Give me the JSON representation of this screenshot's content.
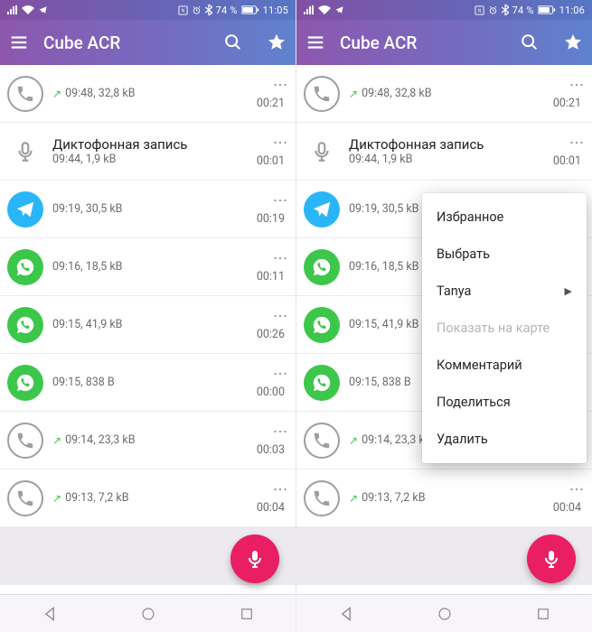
{
  "left": {
    "statusbar": {
      "battery": "74 %",
      "time": "11:05"
    },
    "appbar": {
      "title": "Cube ACR"
    }
  },
  "right": {
    "statusbar": {
      "battery": "74 %",
      "time": "11:06"
    },
    "appbar": {
      "title": "Cube ACR"
    }
  },
  "rows": [
    {
      "type": "phone",
      "title": " ",
      "arrow": true,
      "meta": "09:48, 32,8 kB",
      "dur": "00:21"
    },
    {
      "type": "mic",
      "title": "Диктофонная запись",
      "arrow": false,
      "meta": "09:44, 1,9 kB",
      "dur": "00:01"
    },
    {
      "type": "telegram",
      "title": " ",
      "arrow": false,
      "meta": "09:19, 30,5 kB",
      "dur": "00:19"
    },
    {
      "type": "whatsapp",
      "title": " ",
      "arrow": false,
      "meta": "09:16, 18,5 kB",
      "dur": "00:11"
    },
    {
      "type": "whatsapp",
      "title": " ",
      "arrow": false,
      "meta": "09:15, 41,9 kB",
      "dur": "00:26"
    },
    {
      "type": "whatsapp",
      "title": " ",
      "arrow": false,
      "meta": "09:15, 838 B",
      "dur": "00:00"
    },
    {
      "type": "phone",
      "title": " ",
      "arrow": true,
      "meta": "09:14, 23,3 kB",
      "dur": "00:03"
    },
    {
      "type": "phone",
      "title": " ",
      "arrow": true,
      "meta": "09:13, 7,2 kB",
      "dur": "00:04"
    }
  ],
  "ctx": {
    "items": [
      {
        "label": "Избранное",
        "disabled": false,
        "sub": false
      },
      {
        "label": "Выбрать",
        "disabled": false,
        "sub": false
      },
      {
        "label": "Tanya",
        "disabled": false,
        "sub": true
      },
      {
        "label": "Показать на карте",
        "disabled": true,
        "sub": false
      },
      {
        "label": "Комментарий",
        "disabled": false,
        "sub": false
      },
      {
        "label": "Поделиться",
        "disabled": false,
        "sub": false
      },
      {
        "label": "Удалить",
        "disabled": false,
        "sub": false
      }
    ]
  }
}
